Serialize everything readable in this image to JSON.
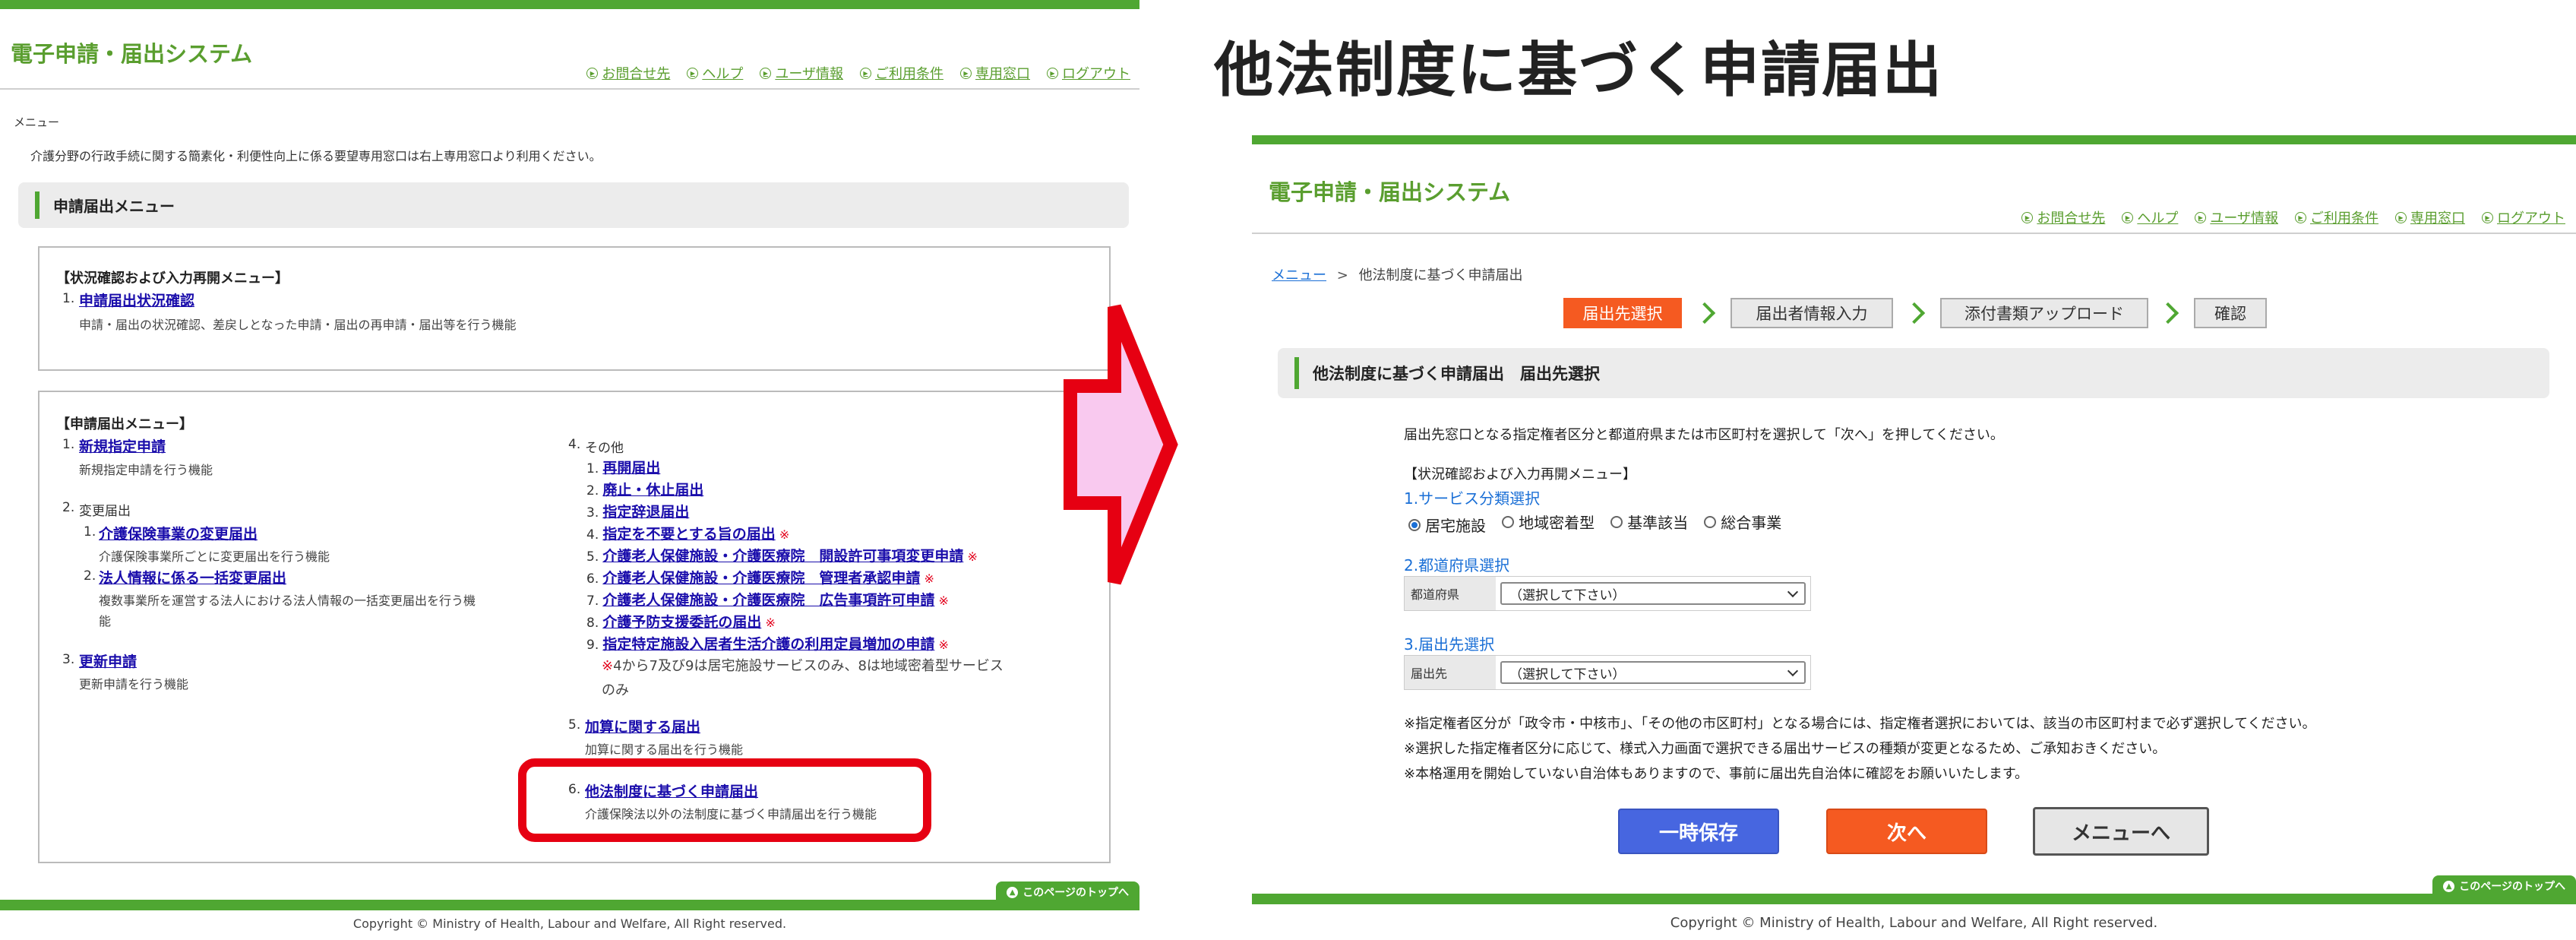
{
  "left": {
    "system_title": "電子申請・届出システム",
    "top_links": [
      "お問合せ先",
      "ヘルプ",
      "ユーザ情報",
      "ご利用条件",
      "専用窓口",
      "ログアウト"
    ],
    "menu_label": "メニュー",
    "notice": "介護分野の行政手続に関する簡素化・利便性向上に係る要望専用窓口は右上専用窓口より利用ください。",
    "section_title": "申請届出メニュー",
    "status_box": {
      "heading": "【状況確認および入力再開メニュー】",
      "item_num": "1.",
      "item_link": "申請届出状況確認",
      "item_desc": "申請・届出の状況確認、差戻しとなった申請・届出の再申請・届出等を行う機能"
    },
    "apply_box": {
      "heading": "【申請届出メニュー】",
      "i1_num": "1.",
      "i1_link": "新規指定申請",
      "i1_desc": "新規指定申請を行う機能",
      "i2_num": "2.",
      "i2_title": "変更届出",
      "i2_1_num": "1.",
      "i2_1_link": "介護保険事業の変更届出",
      "i2_1_desc": "介護保険事業所ごとに変更届出を行う機能",
      "i2_2_num": "2.",
      "i2_2_link": "法人情報に係る一括変更届出",
      "i2_2_desc1": "複数事業所を運営する法人における法人情報の一括変更届出を行う機",
      "i2_2_desc2": "能",
      "i3_num": "3.",
      "i3_link": "更新申請",
      "i3_desc": "更新申請を行う機能",
      "i4_num": "4.",
      "i4_title": "その他",
      "i4_items": [
        {
          "num": "1.",
          "link": "再開届出",
          "mark": ""
        },
        {
          "num": "2.",
          "link": "廃止・休止届出",
          "mark": ""
        },
        {
          "num": "3.",
          "link": "指定辞退届出",
          "mark": ""
        },
        {
          "num": "4.",
          "link": "指定を不要とする旨の届出",
          "mark": "※"
        },
        {
          "num": "5.",
          "link": "介護老人保健施設・介護医療院　開設許可事項変更申請",
          "mark": "※"
        },
        {
          "num": "6.",
          "link": "介護老人保健施設・介護医療院　管理者承認申請",
          "mark": "※"
        },
        {
          "num": "7.",
          "link": "介護老人保健施設・介護医療院　広告事項許可申請",
          "mark": "※"
        },
        {
          "num": "8.",
          "link": "介護予防支援委託の届出",
          "mark": "※"
        },
        {
          "num": "9.",
          "link": "指定特定施設入居者生活介護の利用定員増加の申請",
          "mark": "※"
        }
      ],
      "i4_note_mark": "※",
      "i4_note1": "4から7及び9は居宅施設サービスのみ、8は地域密着型サービス",
      "i4_note2": "のみ",
      "i5_num": "5.",
      "i5_link": "加算に関する届出",
      "i5_desc": "加算に関する届出を行う機能",
      "i6_num": "6.",
      "i6_link": "他法制度に基づく申請届出",
      "i6_desc": "介護保険法以外の法制度に基づく申請届出を行う機能"
    },
    "pagetop": "このページのトップへ",
    "copyright": "Copyright © Ministry of Health, Labour and Welfare, All Right reserved."
  },
  "right": {
    "big_title": "他法制度に基づく申請届出",
    "system_title": "電子申請・届出システム",
    "top_links": [
      "お問合せ先",
      "ヘルプ",
      "ユーザ情報",
      "ご利用条件",
      "専用窓口",
      "ログアウト"
    ],
    "breadcrumb_home": "メニュー",
    "breadcrumb_sep": ">",
    "breadcrumb_current": "他法制度に基づく申請届出",
    "steps": [
      "届出先選択",
      "届出者情報入力",
      "添付書類アップロード",
      "確認"
    ],
    "section_title": "他法制度に基づく申請届出　届出先選択",
    "instruction": "届出先窓口となる指定権者区分と都道府県または市区町村を選択して「次へ」を押してください。",
    "status_heading": "【状況確認および入力再開メニュー】",
    "service_label": "1.サービス分類選択",
    "service_options": [
      "居宅施設",
      "地域密着型",
      "基準該当",
      "総合事業"
    ],
    "pref_label": "2.都道府県選択",
    "pref_field": "都道府県",
    "pref_value": "（選択して下さい）",
    "dest_label": "3.届出先選択",
    "dest_field": "届出先",
    "dest_value": "（選択して下さい）",
    "notes": [
      "※指定権者区分が「政令市・中核市」、「その他の市区町村」となる場合には、指定権者選択においては、該当の市区町村まで必ず選択してください。",
      "※選択した指定権者区分に応じて、様式入力画面で選択できる届出サービスの種類が変更となるため、ご承知おきください。",
      "※本格運用を開始していない自治体もありますので、事前に届出先自治体に確認をお願いいたします。"
    ],
    "btn_save": "一時保存",
    "btn_next": "次へ",
    "btn_menu": "メニューへ",
    "pagetop": "このページのトップへ",
    "copyright": "Copyright © Ministry of Health, Labour and Welfare, All Right reserved."
  },
  "colors": {
    "brand_green": "#4fa732",
    "accent_orange": "#f55a21",
    "save_blue": "#4766e0",
    "highlight_red": "#e60012",
    "arrow_fill": "#f9c9ef"
  }
}
